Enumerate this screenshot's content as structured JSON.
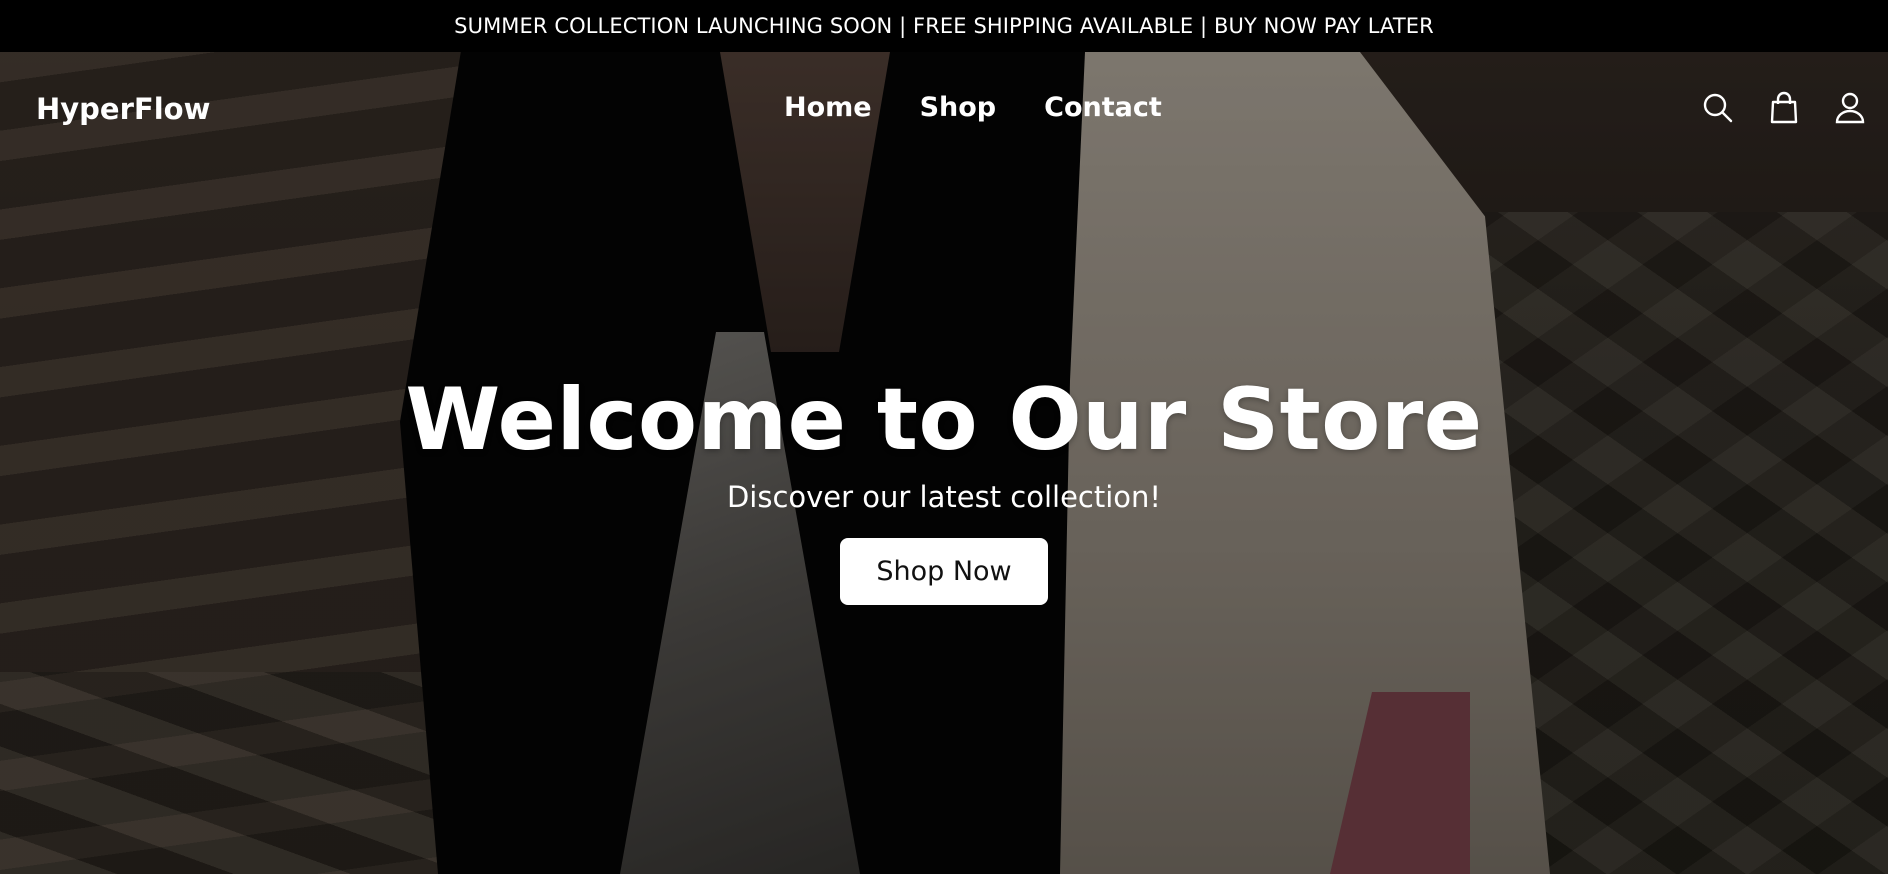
{
  "announcement": "SUMMER COLLECTION LAUNCHING SOON | FREE SHIPPING AVAILABLE | BUY NOW PAY LATER",
  "nav": {
    "logo": "HyperFlow",
    "links": [
      "Home",
      "Shop",
      "Contact"
    ],
    "icons": [
      "search-icon",
      "shopping-bag-icon",
      "user-icon"
    ]
  },
  "hero": {
    "title": "Welcome to Our Store",
    "subtitle": "Discover our latest collection!",
    "button": "Shop Now"
  },
  "colors": {
    "announcement_bg": "#000000",
    "text": "#ffffff",
    "button_bg": "#ffffff",
    "button_text": "#111111"
  }
}
